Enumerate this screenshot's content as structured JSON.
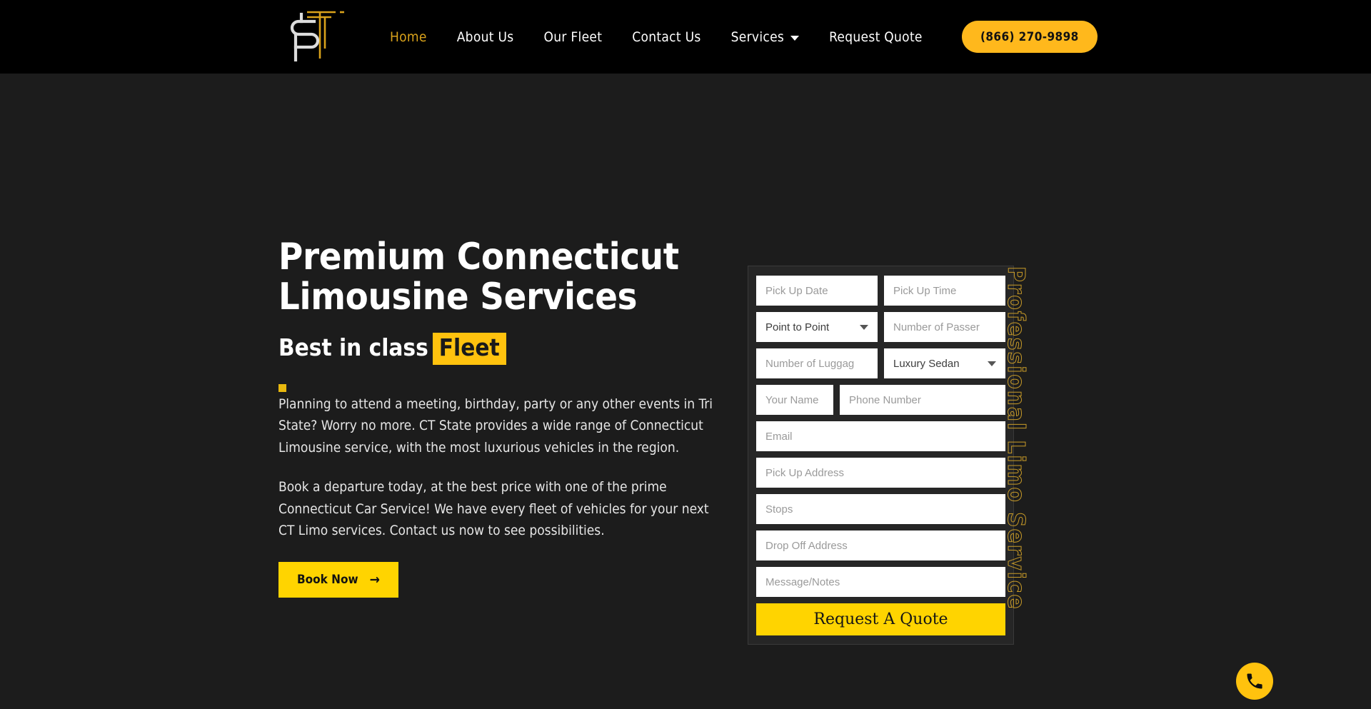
{
  "header": {
    "logo_alt": "ST Connecticut Limo logo",
    "nav": [
      {
        "label": "Home",
        "active": true,
        "caret": false
      },
      {
        "label": "About Us",
        "active": false,
        "caret": false
      },
      {
        "label": "Our Fleet",
        "active": false,
        "caret": false
      },
      {
        "label": "Contact Us",
        "active": false,
        "caret": false
      },
      {
        "label": "Services",
        "active": false,
        "caret": true
      },
      {
        "label": "Request Quote",
        "active": false,
        "caret": false
      }
    ],
    "phone_button": "(866) 270-9898"
  },
  "hero": {
    "heading_line1": "Premium Connecticut",
    "heading_line2": "Limousine Services",
    "subheading_plain": "Best in class",
    "subheading_highlight": "Fleet",
    "paragraph1": "Planning to attend a meeting, birthday, party or any other events in Tri State? Worry no more. CT State provides a wide range of Connecticut Limousine service, with the most luxurious vehicles in the region.",
    "paragraph2": "Book a departure today, at the best price with one of the prime Connecticut Car Service! We have every fleet of vehicles for your next CT Limo services. Contact us now to see possibilities.",
    "cta_label": "Book Now",
    "cta_arrow": "→"
  },
  "form": {
    "pickup_date": "Pick Up Date",
    "pickup_time": "Pick Up Time",
    "trip_type": "Point to Point",
    "passengers": "Number of Passer",
    "luggage": "Number of Luggag",
    "vehicle": "Luxury Sedan",
    "name": "Your Name",
    "phone": "Phone Number",
    "email": "Email",
    "pickup_address": "Pick Up Address",
    "stops": "Stops",
    "dropoff_address": "Drop Off Address",
    "message": "Message/Notes",
    "submit_label": "Request A Quote"
  },
  "side_text": "Professional Limo Service",
  "fab": {
    "icon": "phone-icon"
  },
  "colors": {
    "accent_yellow": "#FFD400",
    "accent_amber": "#FFB81C",
    "gold_outline": "#C79A28",
    "header_bg": "#000000",
    "page_bg": "#1c1c1c"
  }
}
